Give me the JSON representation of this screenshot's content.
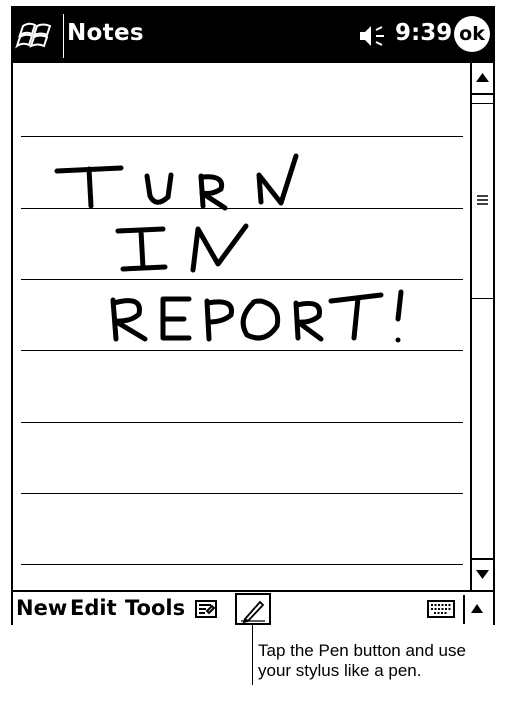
{
  "titlebar": {
    "app_title": "Notes",
    "time": "9:39",
    "ok_label": "ok",
    "icons": [
      "windows-start-icon",
      "volume-icon"
    ]
  },
  "note": {
    "handwriting": [
      "TURN",
      "IN",
      "REPORT!"
    ]
  },
  "menubar": {
    "items": [
      "New",
      "Edit",
      "Tools"
    ],
    "icons": [
      "recorder-icon",
      "pen-icon",
      "keyboard-icon",
      "up-arrow-icon"
    ]
  },
  "callout": {
    "line1": "Tap the Pen button and use",
    "line2": "your stylus like a pen."
  },
  "colors": {
    "foreground": "#000000",
    "background": "#ffffff"
  }
}
